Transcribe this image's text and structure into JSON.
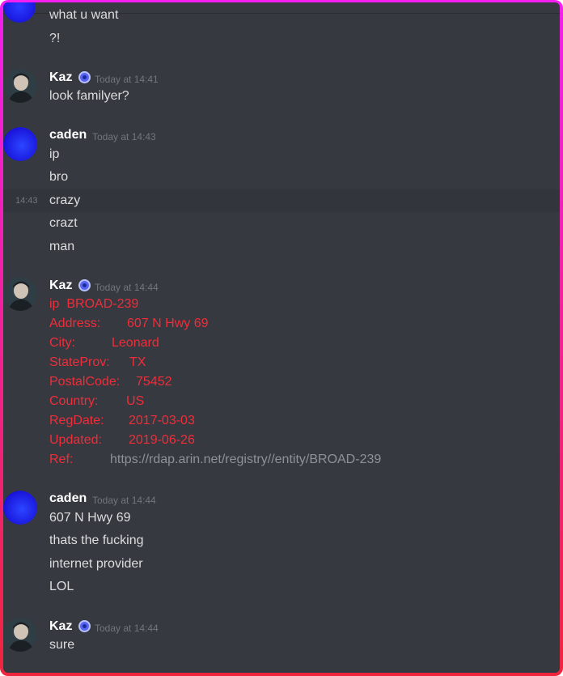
{
  "colors": {
    "frame_top": "#f21ff0",
    "frame_bottom": "#f0243c",
    "background": "#36393f",
    "red_text": "#f02d3a",
    "link_text": "#8e9297"
  },
  "messages": {
    "m0": {
      "lines": [
        "what u want",
        "?!"
      ]
    },
    "m1": {
      "author": "Kaz",
      "badge": "badge-icon",
      "time": "Today at 14:41",
      "lines": [
        "look familyer?"
      ]
    },
    "m2": {
      "author": "caden",
      "time": "Today at 14:43",
      "lines": [
        "ip",
        "bro"
      ],
      "hover_time": "14:43",
      "hover_line": "crazy",
      "more": [
        "crazt",
        "man"
      ]
    },
    "m3": {
      "author": "Kaz",
      "time": "Today at 14:44",
      "rows": [
        {
          "key": "ip",
          "value": "BROAD-239"
        },
        {
          "key": "Address:",
          "value": "607 N Hwy 69"
        },
        {
          "key": "City:",
          "value": "Leonard"
        },
        {
          "key": "StateProv:",
          "value": "TX"
        },
        {
          "key": "PostalCode:",
          "value": "75452"
        },
        {
          "key": "Country:",
          "value": "US"
        },
        {
          "key": "RegDate:",
          "value": "2017-03-03"
        },
        {
          "key": "Updated:",
          "value": "2019-06-26"
        },
        {
          "key": "Ref:",
          "value": "https://rdap.arin.net/registry//entity/BROAD-239"
        }
      ]
    },
    "m4": {
      "author": "caden",
      "time": "Today at 14:44",
      "lines": [
        "607 N Hwy 69",
        "thats the fucking",
        "internet provider",
        "LOL"
      ]
    },
    "m5": {
      "author": "Kaz",
      "time": "Today at 14:44",
      "lines": [
        "sure"
      ]
    }
  }
}
